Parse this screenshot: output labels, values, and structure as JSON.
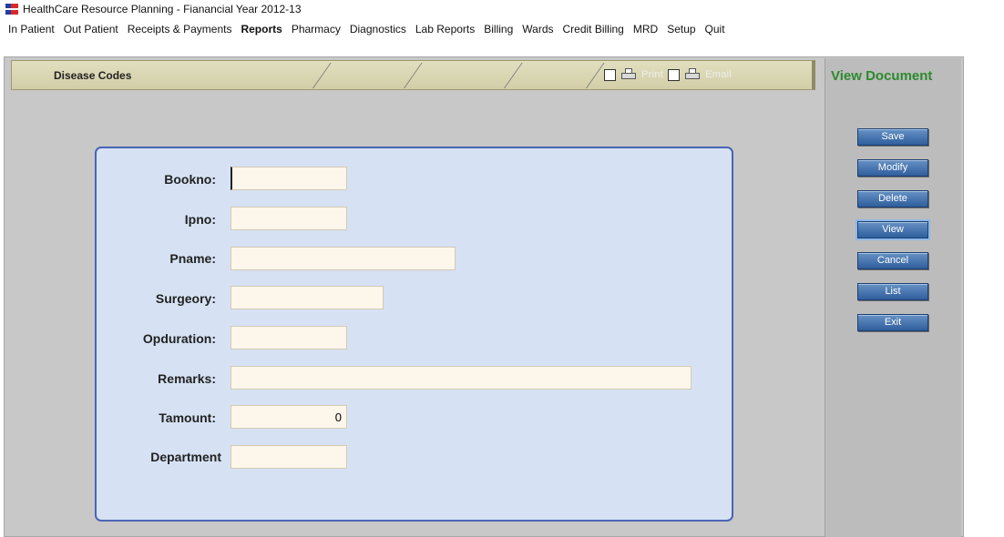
{
  "window": {
    "title": "HealthCare Resource Planning - Fianancial Year 2012-13"
  },
  "menu": [
    {
      "label": "In Patient",
      "bold": false
    },
    {
      "label": "Out Patient",
      "bold": false
    },
    {
      "label": "Receipts & Payments",
      "bold": false
    },
    {
      "label": "Reports",
      "bold": true
    },
    {
      "label": "Pharmacy",
      "bold": false
    },
    {
      "label": "Diagnostics",
      "bold": false
    },
    {
      "label": "Lab Reports",
      "bold": false
    },
    {
      "label": "Billing",
      "bold": false
    },
    {
      "label": "Wards",
      "bold": false
    },
    {
      "label": "Credit Billing",
      "bold": false
    },
    {
      "label": "MRD",
      "bold": false
    },
    {
      "label": "Setup",
      "bold": false
    },
    {
      "label": "Quit",
      "bold": false
    }
  ],
  "header": {
    "form_title": "Disease Codes",
    "print_label": "Print",
    "email_label": "Email"
  },
  "side_panel": {
    "title": "View Document",
    "buttons": [
      "Save",
      "Modify",
      "Delete",
      "View",
      "Cancel",
      "List",
      "Exit"
    ]
  },
  "form": {
    "bookno": {
      "label": "Bookno:",
      "value": ""
    },
    "ipno": {
      "label": "Ipno:",
      "value": ""
    },
    "pname": {
      "label": "Pname:",
      "value": ""
    },
    "surgeory": {
      "label": "Surgeory:",
      "value": ""
    },
    "opduration": {
      "label": "Opduration:",
      "value": ""
    },
    "remarks": {
      "label": "Remarks:",
      "value": ""
    },
    "tamount": {
      "label": "Tamount:",
      "value": "0"
    },
    "department": {
      "label": "Department",
      "value": ""
    }
  },
  "colors": {
    "accent_green": "#2c8a2c",
    "button_blue": "#2f5e9d",
    "form_border": "#4a64b4",
    "form_bg": "#d6e2f4",
    "field_bg": "#fdf6ea"
  }
}
